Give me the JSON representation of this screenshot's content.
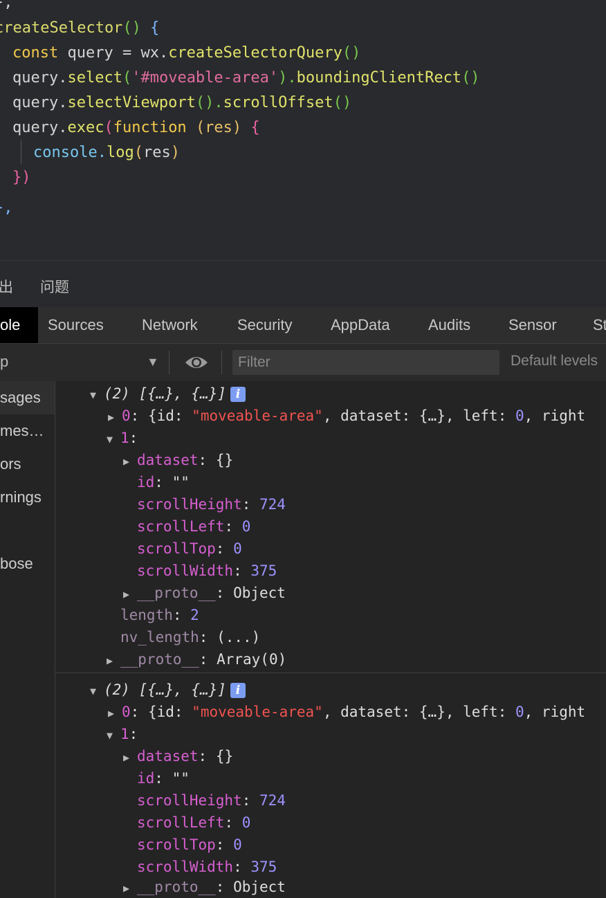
{
  "editor": {
    "lines": {
      "l0": {
        "a": "},"
      },
      "l1": {
        "name": "createSelector",
        "paren": "()",
        "brace": " {"
      },
      "l2": {
        "kw": "const",
        "var": " query ",
        "eq": "=",
        "obj": " wx.",
        "fn": "createSelectorQuery",
        "paren": "()"
      },
      "l3": {
        "obj": "query.",
        "fn": "select",
        "po": "(",
        "str": "'#moveable-area'",
        "pc": ").",
        "fn2": "boundingClientRect",
        "paren": "()"
      },
      "l4": {
        "obj": "query.",
        "fn": "selectViewport",
        "po": "().",
        "fn2": "scrollOffset",
        "paren": "()"
      },
      "l5": {
        "obj": "query.",
        "fn": "exec",
        "po": "(",
        "kw": "function",
        "sp": " ",
        "param": "(res)",
        "brace": " {"
      },
      "l6": {
        "obj": "console.",
        "fn": "log",
        "po": "(",
        "arg": "res",
        "pc": ")"
      },
      "l7": {
        "a": "})"
      },
      "l8": {
        "a": "},"
      }
    }
  },
  "panel_tabs": [
    "出",
    "问题"
  ],
  "devtools_tabs": [
    "ole",
    "Sources",
    "Network",
    "Security",
    "AppData",
    "Audits",
    "Sensor",
    "St"
  ],
  "toolbar": {
    "context_value": "p",
    "filter_placeholder": "Filter",
    "levels_label": "Default levels"
  },
  "sidebar": [
    "sages",
    "mes…",
    "ors",
    "rnings",
    "",
    "bose"
  ],
  "console": {
    "messages": [
      {
        "summary": "(2) [{…}, {…}]",
        "item0_index": "0",
        "item0_open": "{id: ",
        "item0_id": "\"moveable-area\"",
        "item0_mid": ", dataset: {…}, left: ",
        "item0_left": "0",
        "item0_tail": ", right",
        "item1_index": "1",
        "props": [
          {
            "key": "dataset",
            "value": "{}"
          },
          {
            "key": "id",
            "value": "\"\""
          },
          {
            "key": "scrollHeight",
            "value": "724"
          },
          {
            "key": "scrollLeft",
            "value": "0"
          },
          {
            "key": "scrollTop",
            "value": "0"
          },
          {
            "key": "scrollWidth",
            "value": "375"
          },
          {
            "key": "__proto__",
            "value": "Object"
          }
        ],
        "length_key": "length",
        "length_value": "2",
        "nv_key": "nv_length",
        "nv_value": "(...)",
        "proto_key": "__proto__",
        "proto_value": "Array(0)"
      },
      {
        "summary": "(2) [{…}, {…}]",
        "item0_index": "0",
        "item0_open": "{id: ",
        "item0_id": "\"moveable-area\"",
        "item0_mid": ", dataset: {…}, left: ",
        "item0_left": "0",
        "item0_tail": ", right",
        "item1_index": "1",
        "props": [
          {
            "key": "dataset",
            "value": "{}"
          },
          {
            "key": "id",
            "value": "\"\""
          },
          {
            "key": "scrollHeight",
            "value": "724"
          },
          {
            "key": "scrollLeft",
            "value": "0"
          },
          {
            "key": "scrollTop",
            "value": "0"
          },
          {
            "key": "scrollWidth",
            "value": "375"
          },
          {
            "key": "__proto__",
            "value": "Object"
          }
        ]
      }
    ],
    "info_badge": "i"
  }
}
